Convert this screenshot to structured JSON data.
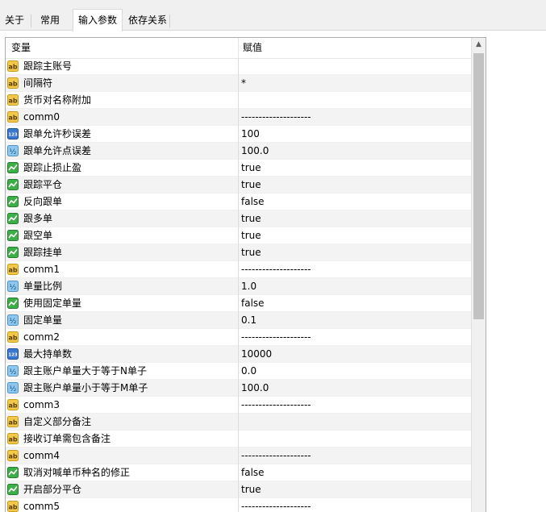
{
  "tabs": [
    {
      "label": "关于",
      "active": false
    },
    {
      "label": "常用",
      "active": false
    },
    {
      "label": "输入参数",
      "active": true
    },
    {
      "label": "依存关系",
      "active": false
    }
  ],
  "grid": {
    "headers": {
      "variable": "变量",
      "value": "赋值"
    },
    "rows": [
      {
        "type": "string",
        "icon": "ab-icon",
        "name": "跟踪主账号",
        "value": ""
      },
      {
        "type": "string",
        "icon": "ab-icon",
        "name": "间隔符",
        "value": "*"
      },
      {
        "type": "string",
        "icon": "ab-icon",
        "name": "货币对名称附加",
        "value": ""
      },
      {
        "type": "string",
        "icon": "ab-icon",
        "name": "comm0",
        "value": "--------------------"
      },
      {
        "type": "int",
        "icon": "int-123-icon",
        "name": "跟单允许秒误差",
        "value": "100"
      },
      {
        "type": "double",
        "icon": "double-v2-icon",
        "name": "跟单允许点误差",
        "value": "100.0"
      },
      {
        "type": "bool",
        "icon": "bool-chart-icon",
        "name": "跟踪止损止盈",
        "value": "true"
      },
      {
        "type": "bool",
        "icon": "bool-chart-icon",
        "name": "跟踪平仓",
        "value": "true"
      },
      {
        "type": "bool",
        "icon": "bool-chart-icon",
        "name": "反向跟单",
        "value": "false"
      },
      {
        "type": "bool",
        "icon": "bool-chart-icon",
        "name": "跟多单",
        "value": "true"
      },
      {
        "type": "bool",
        "icon": "bool-chart-icon",
        "name": "跟空单",
        "value": "true"
      },
      {
        "type": "bool",
        "icon": "bool-chart-icon",
        "name": "跟踪挂单",
        "value": "true"
      },
      {
        "type": "string",
        "icon": "ab-icon",
        "name": "comm1",
        "value": "--------------------"
      },
      {
        "type": "double",
        "icon": "double-v2-icon",
        "name": "单量比例",
        "value": "1.0"
      },
      {
        "type": "bool",
        "icon": "bool-chart-icon",
        "name": "使用固定单量",
        "value": "false"
      },
      {
        "type": "double",
        "icon": "double-v2-icon",
        "name": "固定单量",
        "value": "0.1"
      },
      {
        "type": "string",
        "icon": "ab-icon",
        "name": "comm2",
        "value": "--------------------"
      },
      {
        "type": "int",
        "icon": "int-123-icon",
        "name": "最大持单数",
        "value": "10000"
      },
      {
        "type": "double",
        "icon": "double-v2-icon",
        "name": "跟主账户单量大于等于N单子",
        "value": "0.0"
      },
      {
        "type": "double",
        "icon": "double-v2-icon",
        "name": "跟主账户单量小于等于M单子",
        "value": "100.0"
      },
      {
        "type": "string",
        "icon": "ab-icon",
        "name": "comm3",
        "value": "--------------------"
      },
      {
        "type": "string",
        "icon": "ab-icon",
        "name": "自定义部分备注",
        "value": ""
      },
      {
        "type": "string",
        "icon": "ab-icon",
        "name": "接收订单需包含备注",
        "value": ""
      },
      {
        "type": "string",
        "icon": "ab-icon",
        "name": "comm4",
        "value": "--------------------"
      },
      {
        "type": "bool",
        "icon": "bool-chart-icon",
        "name": "取消对喊单币种名的修正",
        "value": "false"
      },
      {
        "type": "bool",
        "icon": "bool-chart-icon",
        "name": "开启部分平仓",
        "value": "true"
      },
      {
        "type": "string",
        "icon": "ab-icon",
        "name": "comm5",
        "value": "--------------------"
      }
    ]
  },
  "scrollbar": {
    "up_glyph": "▲"
  },
  "icon_glyphs": {
    "ab": "ab",
    "int": "123",
    "double": "½"
  },
  "colors": {
    "ab_bg": "#f3c94a",
    "ab_border": "#c99a1e",
    "int_bg": "#3a78d0",
    "double_bg": "#8fc8ee",
    "bool_bg": "#3fae49",
    "tab_border": "#d9d9d9"
  }
}
